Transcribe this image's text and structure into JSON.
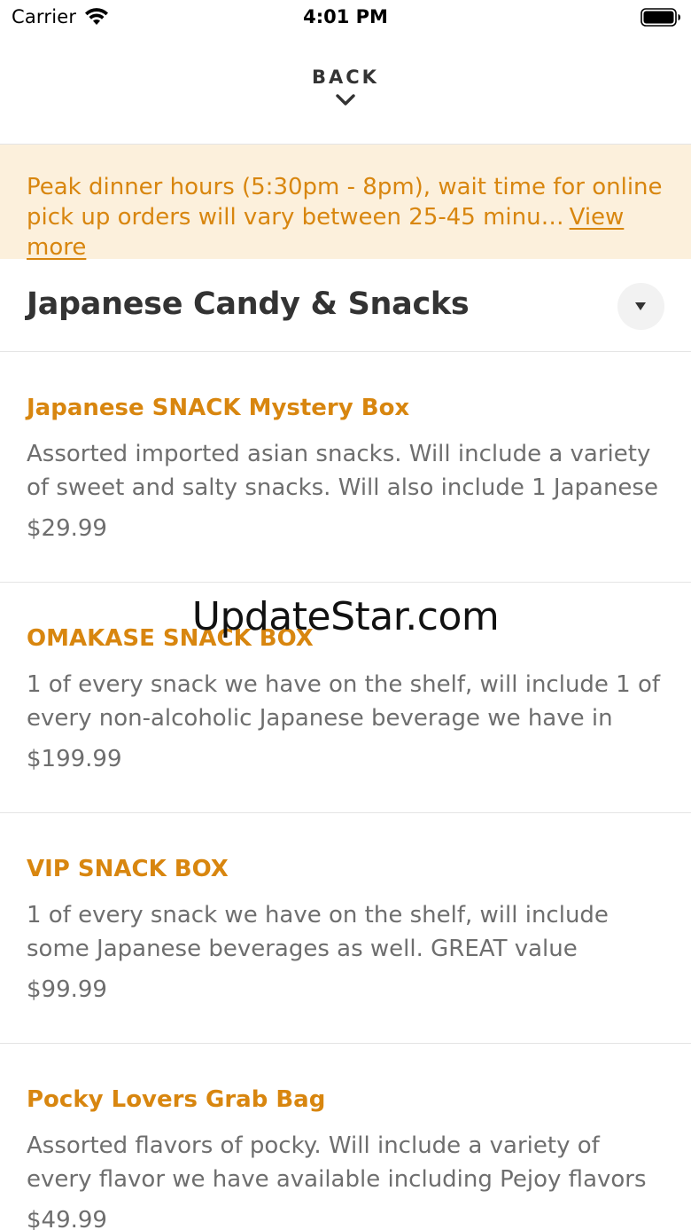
{
  "status_bar": {
    "carrier": "Carrier",
    "time": "4:01 PM"
  },
  "header": {
    "back_label": "BACK"
  },
  "notice": {
    "text": "Peak dinner hours (5:30pm - 8pm), wait time for online pick up orders will vary between 25-45 minu…",
    "link": "View more"
  },
  "category": {
    "title": "Japanese Candy & Snacks"
  },
  "products": [
    {
      "name": "Japanese SNACK Mystery Box",
      "description": "Assorted imported asian snacks. Will include a variety of sweet and salty snacks. Will also include 1 Japanese",
      "price": "$29.99"
    },
    {
      "name": "OMAKASE SNACK BOX",
      "description": "1 of every snack we have on the shelf, will include 1 of every non-alcoholic Japanese beverage we have in stock",
      "price": "$199.99"
    },
    {
      "name": "VIP SNACK BOX",
      "description": "1 of every snack we have on the shelf, will include some Japanese beverages as well. GREAT value purchase. Will",
      "price": "$99.99"
    },
    {
      "name": "Pocky Lovers Grab Bag",
      "description": "Assorted flavors of pocky. Will include a variety of every flavor we have available including Pejoy flavors as well.",
      "price": "$49.99"
    }
  ],
  "watermark": "UpdateStar.com",
  "colors": {
    "accent": "#d8860f",
    "notice_bg": "#fcf0dc",
    "text_dark": "#333333",
    "text_muted": "#6e6e6e",
    "divider": "#e4e4e4"
  }
}
